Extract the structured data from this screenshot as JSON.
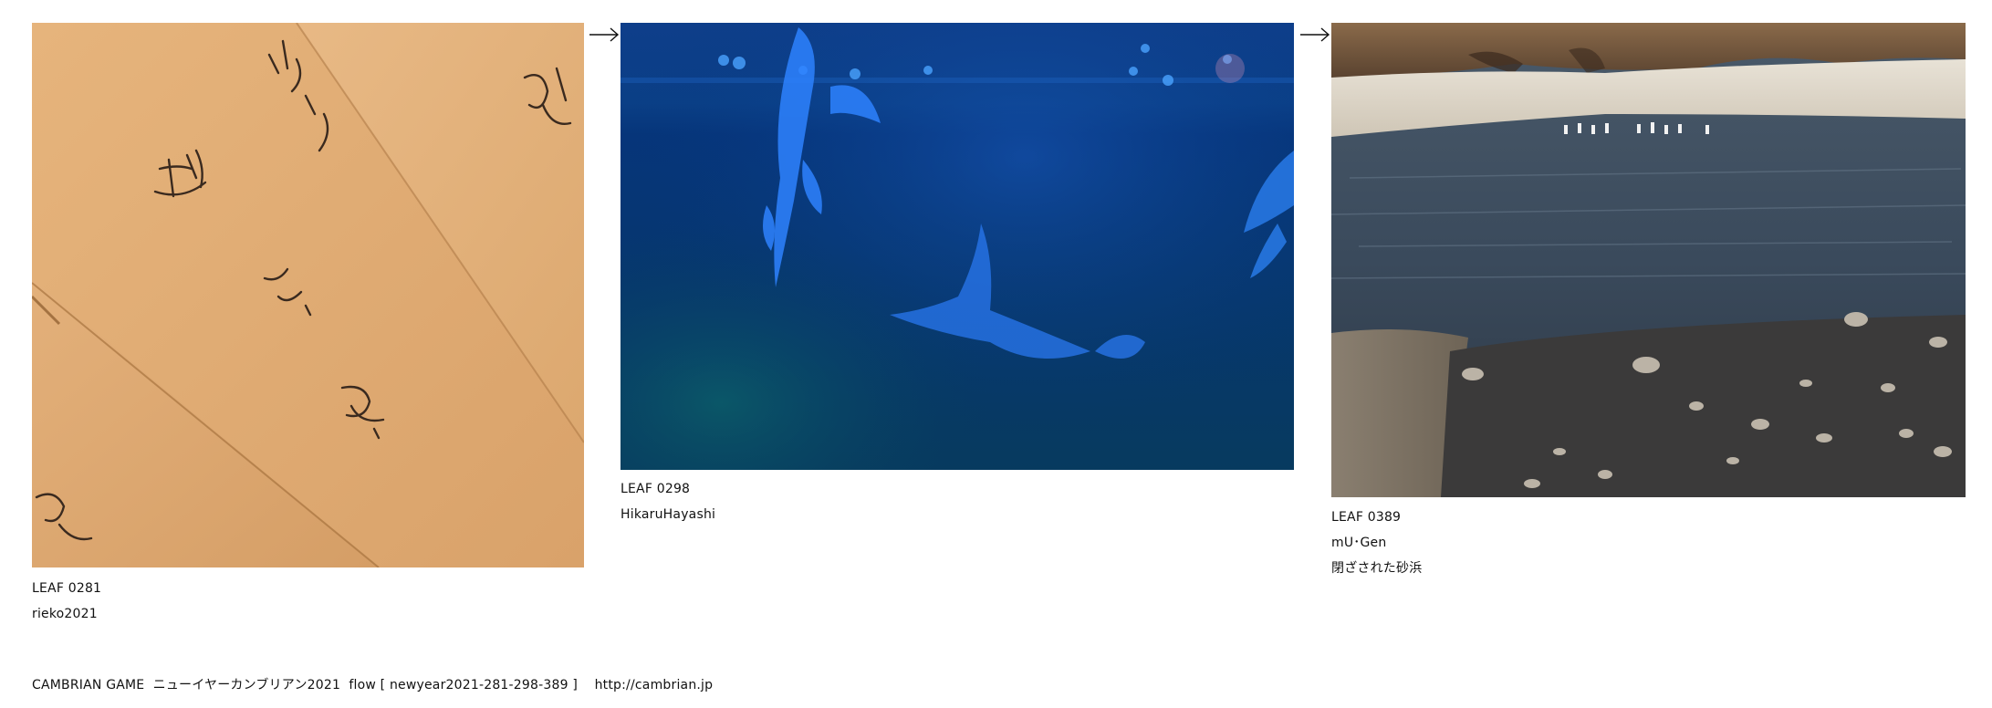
{
  "flow": [
    {
      "leaf_id": "LEAF 0281",
      "author": "rieko2021",
      "title": "",
      "image_icon": "kraft-envelopes-photo"
    },
    {
      "leaf_id": "LEAF 0298",
      "author": "HikaruHayashi",
      "title": "",
      "image_icon": "aquarium-fish-photo"
    },
    {
      "leaf_id": "LEAF 0389",
      "author": "mU･Gen",
      "title": "閉ざされた砂浜",
      "image_icon": "river-beach-photo"
    }
  ],
  "arrow_icon": "right-arrow-icon",
  "footer": {
    "text": "CAMBRIAN GAME  ニューイヤーカンブリアン2021  flow [ newyear2021-281-298-389 ]    http://cambrian.jp"
  }
}
